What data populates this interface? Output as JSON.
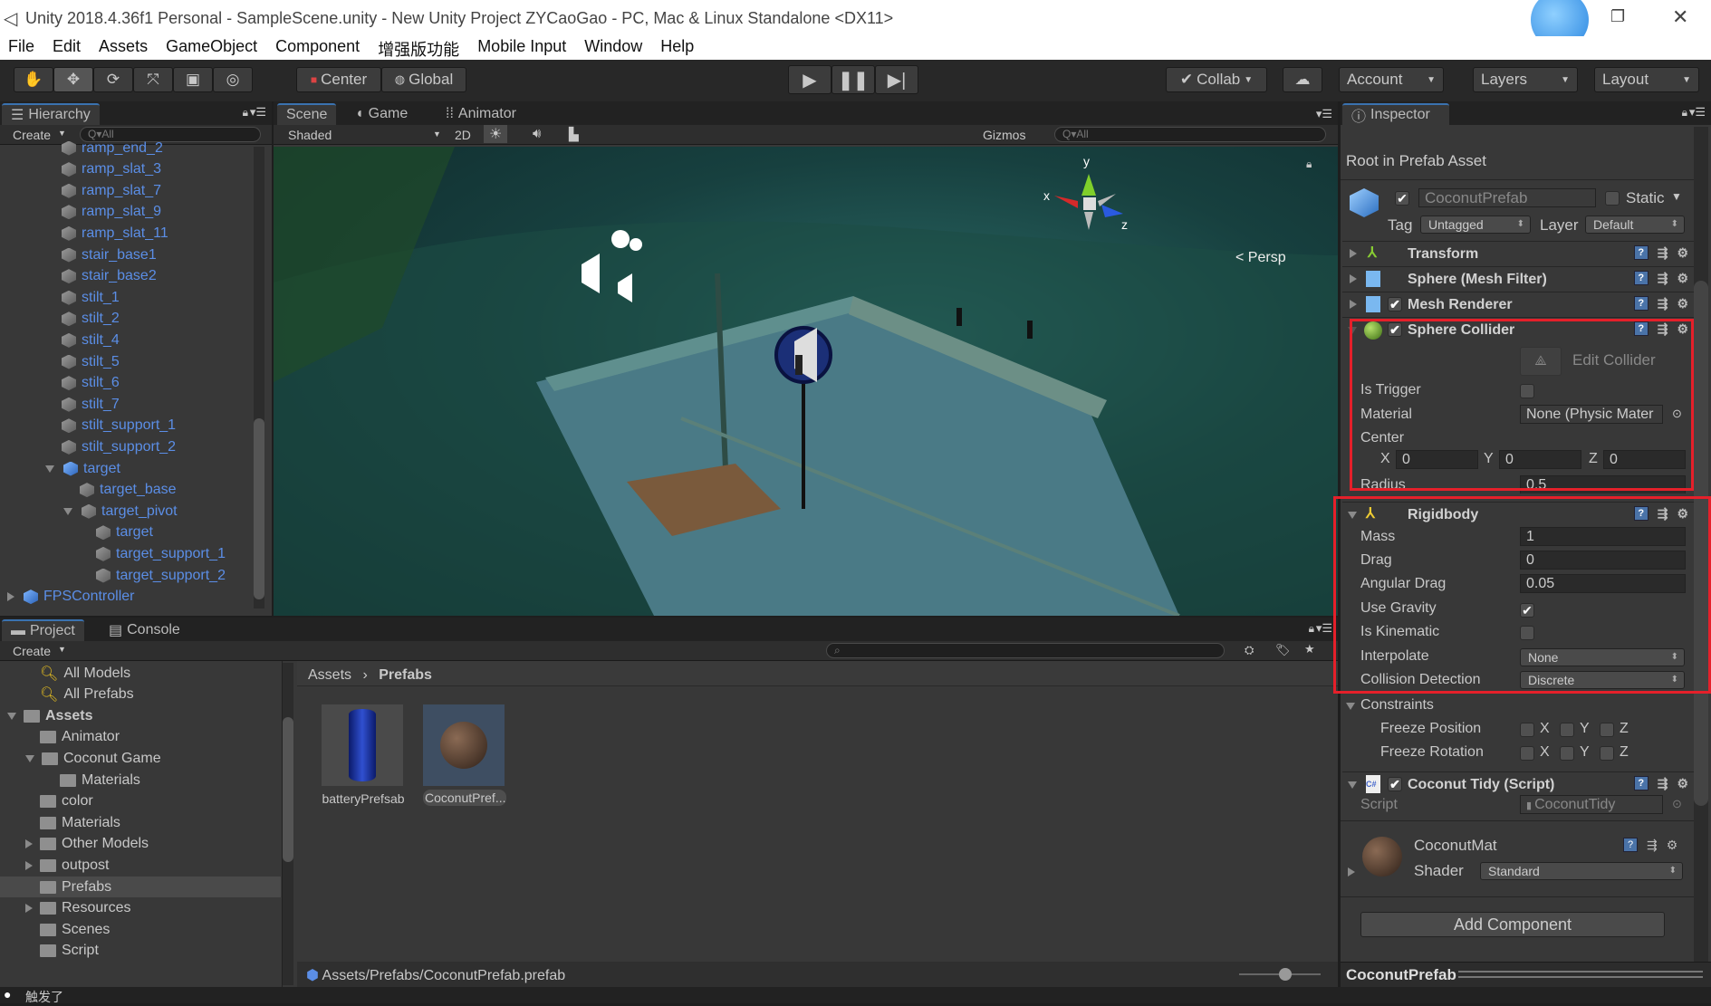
{
  "window": {
    "title": "Unity 2018.4.36f1 Personal - SampleScene.unity - New Unity Project ZYCaoGao - PC, Mac & Linux Standalone <DX11>"
  },
  "menu": [
    "File",
    "Edit",
    "Assets",
    "GameObject",
    "Component",
    "增强版功能",
    "Mobile Input",
    "Window",
    "Help"
  ],
  "toolbar": {
    "center": "Center",
    "global": "Global",
    "collab": "Collab",
    "account": "Account",
    "layers": "Layers",
    "layout": "Layout"
  },
  "hierarchy": {
    "tab": "Hierarchy",
    "create": "Create",
    "search_placeholder": "Q▾All",
    "items": [
      {
        "label": "ramp_end_2",
        "level": 1
      },
      {
        "label": "ramp_slat_3",
        "level": 1
      },
      {
        "label": "ramp_slat_7",
        "level": 1
      },
      {
        "label": "ramp_slat_9",
        "level": 1
      },
      {
        "label": "ramp_slat_11",
        "level": 1
      },
      {
        "label": "stair_base1",
        "level": 1
      },
      {
        "label": "stair_base2",
        "level": 1
      },
      {
        "label": "stilt_1",
        "level": 1
      },
      {
        "label": "stilt_2",
        "level": 1
      },
      {
        "label": "stilt_4",
        "level": 1
      },
      {
        "label": "stilt_5",
        "level": 1
      },
      {
        "label": "stilt_6",
        "level": 1
      },
      {
        "label": "stilt_7",
        "level": 1
      },
      {
        "label": "stilt_support_1",
        "level": 1
      },
      {
        "label": "stilt_support_2",
        "level": 1
      },
      {
        "label": "target",
        "level": 1,
        "expanded": true
      },
      {
        "label": "target_base",
        "level": 2
      },
      {
        "label": "target_pivot",
        "level": 2,
        "expanded": true
      },
      {
        "label": "target",
        "level": 3
      },
      {
        "label": "target_support_1",
        "level": 3
      },
      {
        "label": "target_support_2",
        "level": 3
      },
      {
        "label": "FPSController",
        "level": 0,
        "collapsed": true
      }
    ]
  },
  "scene": {
    "tabs": [
      "Scene",
      "Game",
      "Animator"
    ],
    "shading": "Shaded",
    "mode_2d": "2D",
    "gizmos": "Gizmos",
    "search_placeholder": "Q▾All",
    "persp": "< Persp",
    "axis_x": "x",
    "axis_y": "y",
    "axis_z": "z"
  },
  "project": {
    "tabs": [
      "Project",
      "Console"
    ],
    "create": "Create",
    "tree": [
      {
        "label": "All Models",
        "type": "search"
      },
      {
        "label": "All Prefabs",
        "type": "search"
      },
      {
        "label": "Assets",
        "level": 0,
        "expanded": true,
        "bold": true
      },
      {
        "label": "Animator",
        "level": 1
      },
      {
        "label": "Coconut Game",
        "level": 1,
        "expanded": true
      },
      {
        "label": "Materials",
        "level": 2
      },
      {
        "label": "color",
        "level": 1
      },
      {
        "label": "Materials",
        "level": 1
      },
      {
        "label": "Other Models",
        "level": 1,
        "collapsed": true
      },
      {
        "label": "outpost",
        "level": 1,
        "collapsed": true
      },
      {
        "label": "Prefabs",
        "level": 1,
        "selected": true
      },
      {
        "label": "Resources",
        "level": 1,
        "collapsed": true
      },
      {
        "label": "Scenes",
        "level": 1
      },
      {
        "label": "Script",
        "level": 1
      }
    ],
    "breadcrumb": [
      "Assets",
      "Prefabs"
    ],
    "assets": [
      {
        "label": "batteryPrefsab"
      },
      {
        "label": "CoconutPref...",
        "selected": true
      }
    ],
    "path": "Assets/Prefabs/CoconutPrefab.prefab"
  },
  "inspector": {
    "tab": "Inspector",
    "header": "Root in Prefab Asset",
    "object_name": "CoconutPrefab",
    "static_label": "Static",
    "tag_label": "Tag",
    "tag": "Untagged",
    "layer_label": "Layer",
    "layer": "Default",
    "components": {
      "transform": "Transform",
      "mesh_filter": "Sphere (Mesh Filter)",
      "mesh_renderer": "Mesh Renderer",
      "sphere_collider": "Sphere Collider",
      "rigidbody": "Rigidbody",
      "script": "Coconut Tidy (Script)"
    },
    "collider": {
      "edit": "Edit Collider",
      "is_trigger": "Is Trigger",
      "is_trigger_value": false,
      "material": "Material",
      "material_value": "None (Physic Mater",
      "center": "Center",
      "x": "X",
      "y": "Y",
      "z": "Z",
      "cx": "0",
      "cy": "0",
      "cz": "0",
      "radius": "Radius",
      "radius_value": "0.5"
    },
    "rigidbody": {
      "mass": "Mass",
      "mass_value": "1",
      "drag": "Drag",
      "drag_value": "0",
      "angular_drag": "Angular Drag",
      "angular_drag_value": "0.05",
      "use_gravity": "Use Gravity",
      "use_gravity_value": true,
      "is_kinematic": "Is Kinematic",
      "is_kinematic_value": false,
      "interpolate": "Interpolate",
      "interpolate_value": "None",
      "collision": "Collision Detection",
      "collision_value": "Discrete",
      "constraints": "Constraints",
      "freeze_position": "Freeze Position",
      "freeze_rotation": "Freeze Rotation"
    },
    "script": {
      "label": "Script",
      "value": "CoconutTidy"
    },
    "material": {
      "name": "CoconutMat",
      "shader_label": "Shader",
      "shader": "Standard"
    },
    "add_component": "Add Component",
    "footer": "CoconutPrefab"
  },
  "status": {
    "message": "触发了"
  },
  "colors": {
    "highlight_box": "#e5202a",
    "hierarchy_text": "#5b8ee6",
    "panel": "#383838"
  }
}
